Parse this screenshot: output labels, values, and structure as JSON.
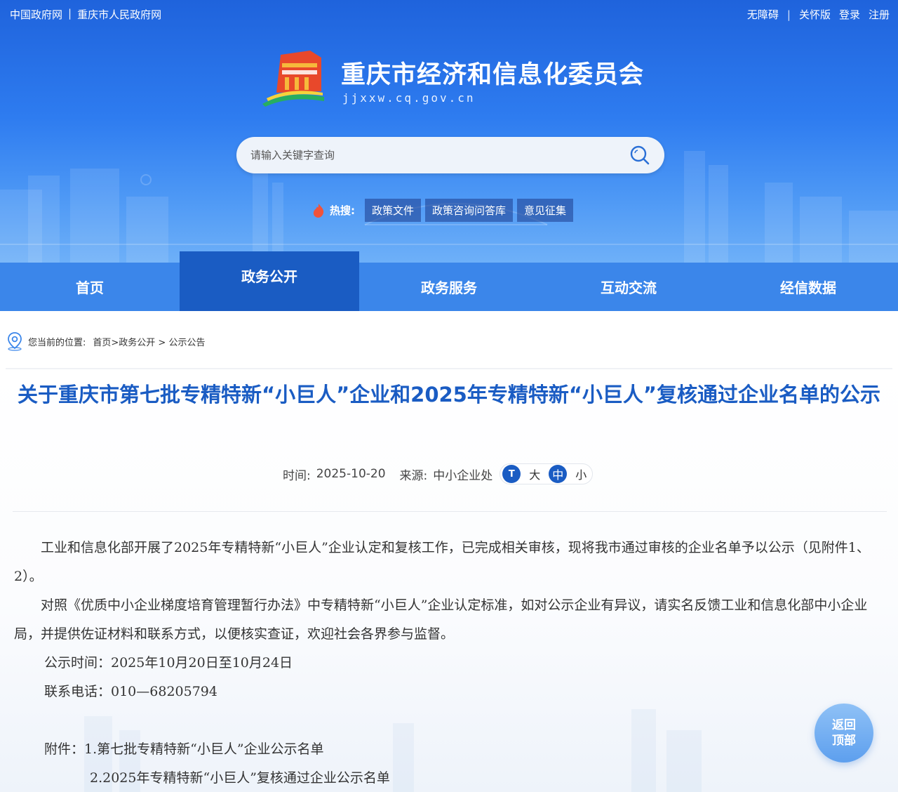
{
  "topbar": {
    "left_links": [
      "中国政府网",
      "重庆市人民政府网"
    ],
    "right_links": [
      "无障碍",
      "关怀版",
      "登录",
      "注册"
    ]
  },
  "site": {
    "title": "重庆市经济和信息化委员会",
    "url": "jjxxw.cq.gov.cn"
  },
  "search": {
    "placeholder": "请输入关键字查询"
  },
  "hot_search": {
    "label": "热搜:",
    "tags": [
      "政策文件",
      "政策咨询问答库",
      "意见征集"
    ]
  },
  "nav": {
    "items": [
      "首页",
      "政务公开",
      "政务服务",
      "互动交流",
      "经信数据"
    ],
    "active": "政务公开"
  },
  "breadcrumb": {
    "label": "您当前的位置:",
    "path": "首页>政务公开 > 公示公告"
  },
  "article": {
    "title": "关于重庆市第七批专精特新“小巨人”企业和2025年专精特新“小巨人”复核通过企业名单的公示",
    "time_label": "时间:",
    "time": "2025-10-20",
    "source_label": "来源:",
    "source": "中小企业处",
    "font_icon": "T",
    "font_sizes": [
      "大",
      "中",
      "小"
    ],
    "font_selected": "中",
    "paragraphs": [
      "工业和信息化部开展了2025年专精特新“小巨人”企业认定和复核工作，已完成相关审核，现将我市通过审核的企业名单予以公示（见附件1、2）。",
      "对照《优质中小企业梯度培育管理暂行办法》中专精特新“小巨人”企业认定标准，如对公示企业有异议，请实名反馈工业和信息化部中小企业局，并提供佐证材料和联系方式，以便核实查证，欢迎社会各界参与监督。"
    ],
    "notice_time": "公示时间：2025年10月20日至10月24日",
    "phone": "联系电话：010—68205794",
    "attachment_1": "附件：1.第七批专精特新“小巨人”企业公示名单",
    "attachment_2": "2.2025年专精特新“小巨人”复核通过企业公示名单"
  },
  "back_to_top": [
    "返回",
    "顶部"
  ],
  "colors": {
    "header_blue": "#2e7cf0",
    "nav_blue": "#3b86ea",
    "nav_active": "#1a5cc3",
    "title_blue": "#1a5cc3"
  }
}
